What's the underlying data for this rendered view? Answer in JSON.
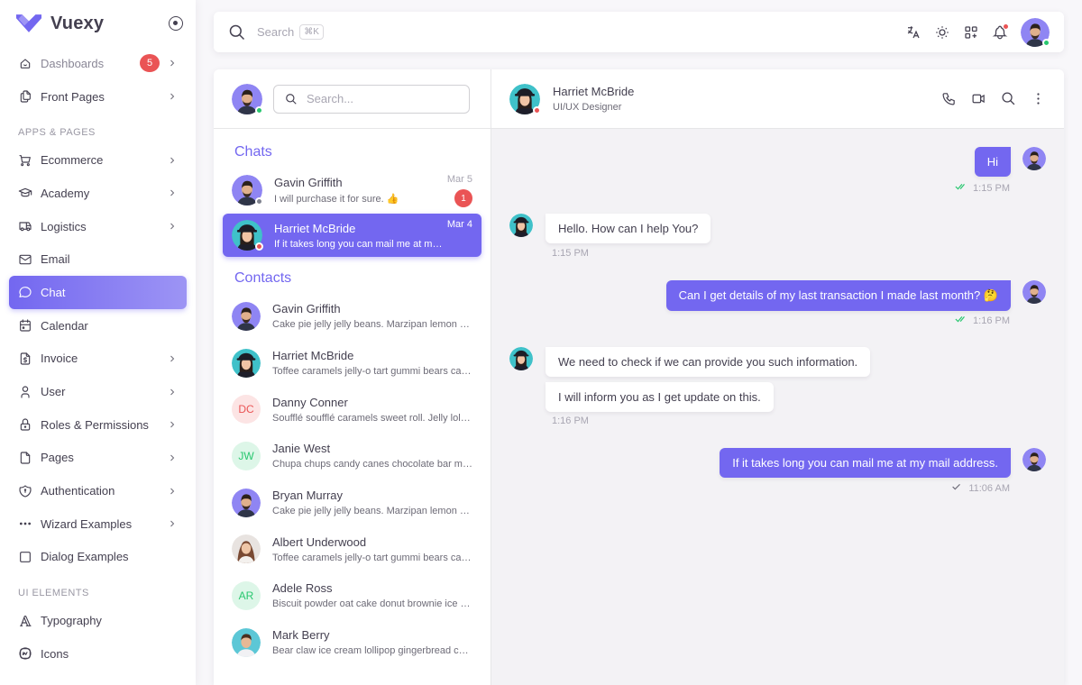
{
  "brand": {
    "name": "Vuexy",
    "color": "#7367f0"
  },
  "sidebar": {
    "items": [
      {
        "label": "Dashboards",
        "icon": "smart-home-icon",
        "badge": "5",
        "chevron": true,
        "muted": true
      },
      {
        "label": "Front Pages",
        "icon": "files-icon",
        "chevron": true
      }
    ],
    "section_apps": "APPS & PAGES",
    "apps": [
      {
        "label": "Ecommerce",
        "icon": "shopping-cart-icon",
        "chevron": true
      },
      {
        "label": "Academy",
        "icon": "graduation-cap-icon",
        "chevron": true
      },
      {
        "label": "Logistics",
        "icon": "truck-icon",
        "chevron": true
      },
      {
        "label": "Email",
        "icon": "mail-icon",
        "chevron": false
      },
      {
        "label": "Chat",
        "icon": "message-circle-icon",
        "chevron": false,
        "active": true
      },
      {
        "label": "Calendar",
        "icon": "calendar-icon",
        "chevron": false
      },
      {
        "label": "Invoice",
        "icon": "file-dollar-icon",
        "chevron": true
      },
      {
        "label": "User",
        "icon": "user-icon",
        "chevron": true
      },
      {
        "label": "Roles & Permissions",
        "icon": "lock-icon",
        "chevron": true
      },
      {
        "label": "Pages",
        "icon": "file-icon",
        "chevron": true
      },
      {
        "label": "Authentication",
        "icon": "shield-icon",
        "chevron": true
      },
      {
        "label": "Wizard Examples",
        "icon": "dots-icon",
        "chevron": true
      },
      {
        "label": "Dialog Examples",
        "icon": "square-icon",
        "chevron": false
      }
    ],
    "section_ui": "UI ELEMENTS",
    "ui": [
      {
        "label": "Typography",
        "icon": "typography-icon",
        "chevron": false
      },
      {
        "label": "Icons",
        "icon": "brand-icon",
        "chevron": false
      }
    ]
  },
  "topbar": {
    "search_placeholder": "Search",
    "shortcut": "⌘K"
  },
  "chat": {
    "search_placeholder": "Search...",
    "chats_title": "Chats",
    "contacts_title": "Contacts",
    "chats": [
      {
        "name": "Gavin Griffith",
        "message": "I will purchase it for sure. 👍",
        "date": "Mar 5",
        "unread": "1",
        "status": "away",
        "avatar": "man-beard"
      },
      {
        "name": "Harriet McBride",
        "message": "If it takes long you can mail me at my mail address.",
        "date": "Mar 4",
        "status": "busy",
        "avatar": "woman-cap",
        "active": true
      }
    ],
    "contacts": [
      {
        "name": "Gavin Griffith",
        "message": "Cake pie jelly jelly beans. Marzipan lemon drops halvah cake.",
        "avatar": "man-beard"
      },
      {
        "name": "Harriet McBride",
        "message": "Toffee caramels jelly-o tart gummi bears cake.",
        "avatar": "woman-cap"
      },
      {
        "name": "Danny Conner",
        "message": "Soufflé soufflé caramels sweet roll. Jelly lollipop.",
        "initials": "DC",
        "color": "#ea5455",
        "bg": "#fce4e4"
      },
      {
        "name": "Janie West",
        "message": "Chupa chups candy canes chocolate bar marshmallow.",
        "initials": "JW",
        "color": "#28c76f",
        "bg": "#ddf6e8"
      },
      {
        "name": "Bryan Murray",
        "message": "Cake pie jelly jelly beans. Marzipan lemon drops halvah cake.",
        "avatar": "man-beard"
      },
      {
        "name": "Albert Underwood",
        "message": "Toffee caramels jelly-o tart gummi bears cake.",
        "avatar": "woman-hair"
      },
      {
        "name": "Adele Ross",
        "message": "Biscuit powder oat cake donut brownie ice cream.",
        "initials": "AR",
        "color": "#28c76f",
        "bg": "#ddf6e8"
      },
      {
        "name": "Mark Berry",
        "message": "Bear claw ice cream lollipop gingerbread carrot cake.",
        "avatar": "man-teal"
      }
    ],
    "active_contact": {
      "name": "Harriet McBride",
      "role": "UI/UX Designer"
    },
    "messages": [
      {
        "side": "out",
        "text": "Hi",
        "time": "1:15 PM",
        "read": true
      },
      {
        "side": "in",
        "text": "Hello. How can I help You?",
        "time": "1:15 PM"
      },
      {
        "side": "out",
        "text": "Can I get details of my last transaction I made last month? 🤔",
        "time": "1:16 PM",
        "read": true
      },
      {
        "side": "in",
        "text": "We need to check if we can provide you such information.",
        "text2": "I will inform you as I get update on this.",
        "time": "1:16 PM"
      },
      {
        "side": "out",
        "text": "If it takes long you can mail me at my mail address.",
        "time": "11:06 AM",
        "read": false
      }
    ]
  }
}
